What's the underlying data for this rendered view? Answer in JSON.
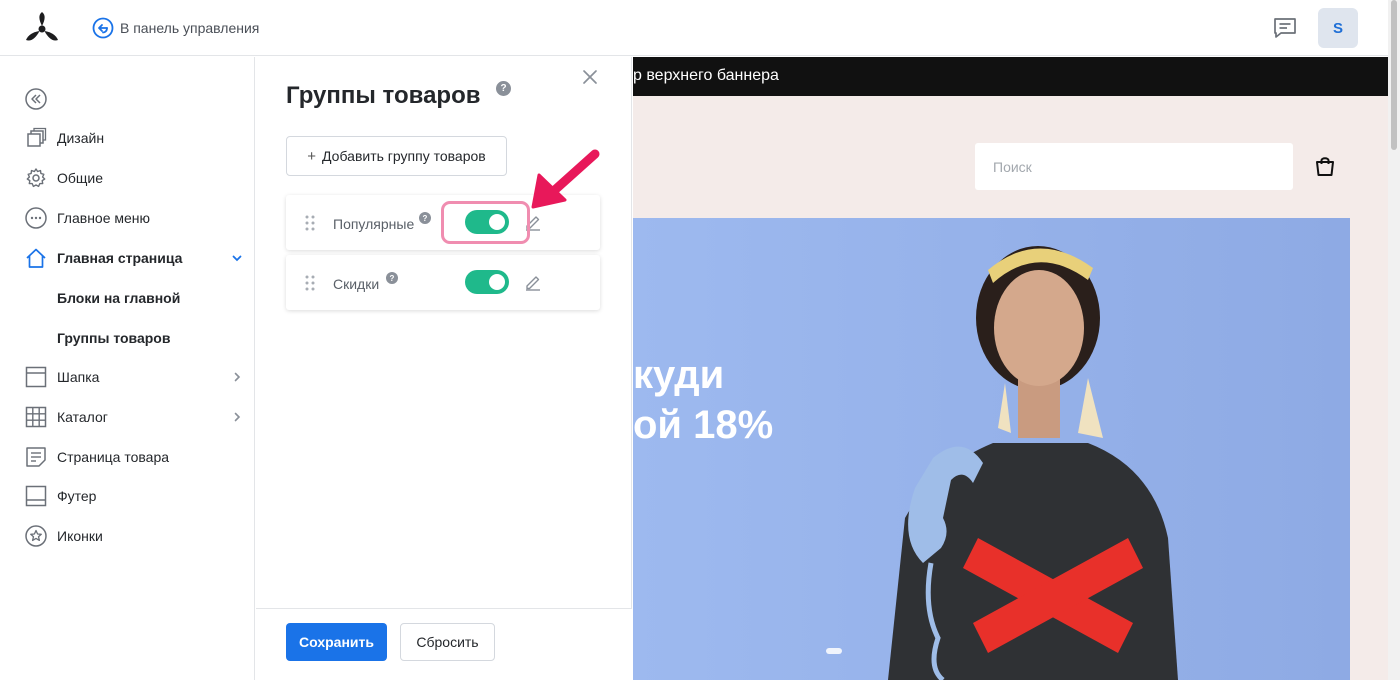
{
  "topbar": {
    "back_label": "В панель управления",
    "avatar_letter": "S"
  },
  "sidebar": {
    "items": [
      {
        "label": "Дизайн",
        "icon": "design-icon"
      },
      {
        "label": "Общие",
        "icon": "gear-icon"
      },
      {
        "label": "Главное меню",
        "icon": "menu-dots-icon"
      },
      {
        "label": "Главная страница",
        "icon": "home-icon",
        "expanded": true
      },
      {
        "label": "Блоки на главной"
      },
      {
        "label": "Группы товаров"
      },
      {
        "label": "Шапка",
        "icon": "header-icon"
      },
      {
        "label": "Каталог",
        "icon": "grid-icon"
      },
      {
        "label": "Страница товара",
        "icon": "document-icon"
      },
      {
        "label": "Футер",
        "icon": "footer-icon"
      },
      {
        "label": "Иконки",
        "icon": "star-icon"
      }
    ]
  },
  "panel": {
    "title": "Группы товаров",
    "help_mark": "?",
    "add_label": "Добавить группу товаров",
    "add_plus": "+",
    "groups": [
      {
        "label": "Популярные",
        "enabled": true
      },
      {
        "label": "Скидки",
        "enabled": true
      }
    ],
    "save_label": "Сохранить",
    "reset_label": "Сбросить"
  },
  "preview": {
    "promo_text": "р верхнего баннера",
    "search_placeholder": "Поиск",
    "banner_line1": "куди",
    "banner_line2": "ой 18%"
  },
  "colors": {
    "accent": "#1a73e8",
    "toggle_on": "#1fb98b",
    "highlight": "#f08db0",
    "arrow": "#e8185a",
    "banner_bg": "#93b0ea"
  }
}
